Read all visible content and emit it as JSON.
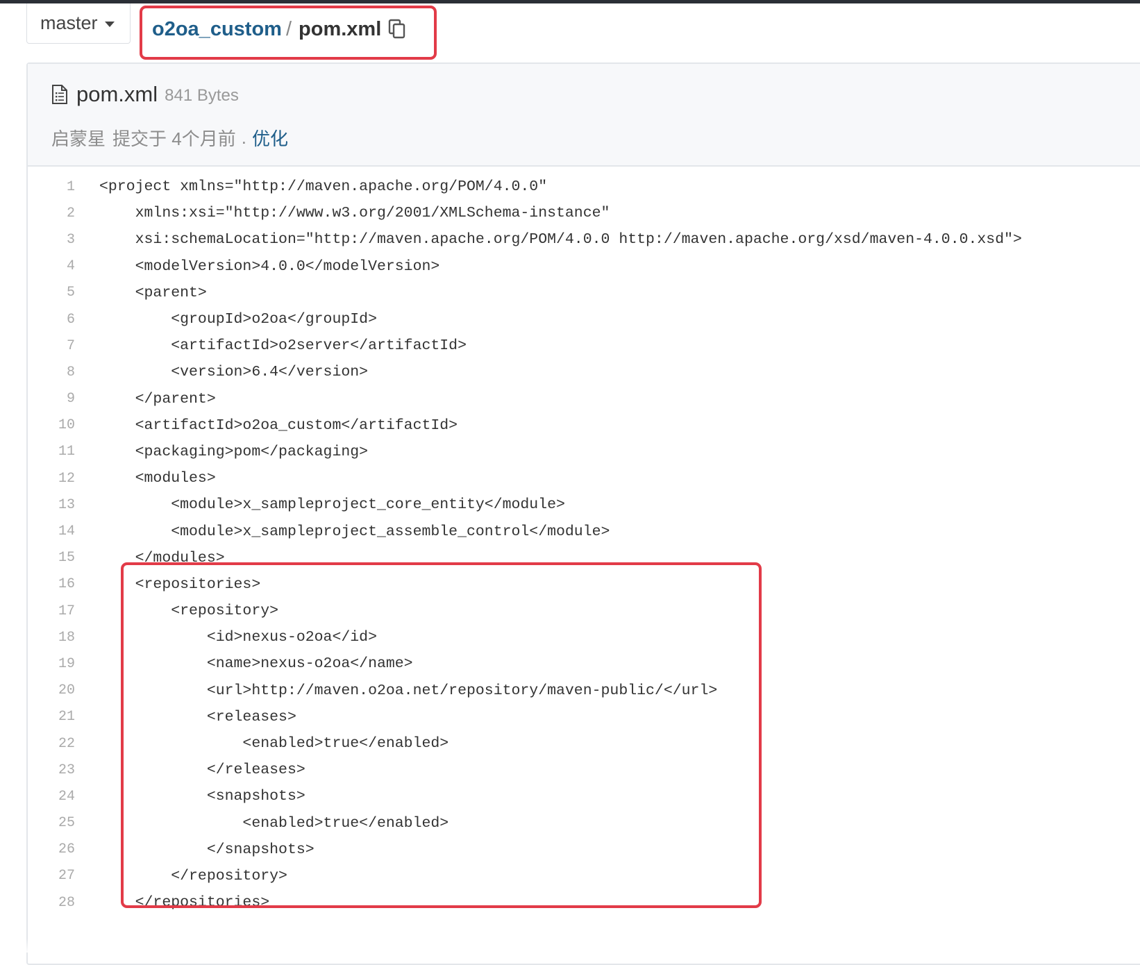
{
  "branch": {
    "label": "master"
  },
  "breadcrumb": {
    "repo": "o2oa_custom",
    "separator": "/",
    "file": "pom.xml"
  },
  "file": {
    "name": "pom.xml",
    "size": "841 Bytes",
    "commit": {
      "author": "启蒙星",
      "action": "提交于 4个月前",
      "dot": ".",
      "message": "优化"
    }
  },
  "code": {
    "lines": [
      {
        "n": "1",
        "text": "<project xmlns=\"http://maven.apache.org/POM/4.0.0\""
      },
      {
        "n": "2",
        "text": "    xmlns:xsi=\"http://www.w3.org/2001/XMLSchema-instance\""
      },
      {
        "n": "3",
        "text": "    xsi:schemaLocation=\"http://maven.apache.org/POM/4.0.0 http://maven.apache.org/xsd/maven-4.0.0.xsd\">"
      },
      {
        "n": "4",
        "text": "    <modelVersion>4.0.0</modelVersion>"
      },
      {
        "n": "5",
        "text": "    <parent>"
      },
      {
        "n": "6",
        "text": "        <groupId>o2oa</groupId>"
      },
      {
        "n": "7",
        "text": "        <artifactId>o2server</artifactId>"
      },
      {
        "n": "8",
        "text": "        <version>6.4</version>"
      },
      {
        "n": "9",
        "text": "    </parent>"
      },
      {
        "n": "10",
        "text": "    <artifactId>o2oa_custom</artifactId>"
      },
      {
        "n": "11",
        "text": "    <packaging>pom</packaging>"
      },
      {
        "n": "12",
        "text": "    <modules>"
      },
      {
        "n": "13",
        "text": "        <module>x_sampleproject_core_entity</module>"
      },
      {
        "n": "14",
        "text": "        <module>x_sampleproject_assemble_control</module>"
      },
      {
        "n": "15",
        "text": "    </modules>"
      },
      {
        "n": "16",
        "text": "    <repositories>"
      },
      {
        "n": "17",
        "text": "        <repository>"
      },
      {
        "n": "18",
        "text": "            <id>nexus-o2oa</id>"
      },
      {
        "n": "19",
        "text": "            <name>nexus-o2oa</name>"
      },
      {
        "n": "20",
        "text": "            <url>http://maven.o2oa.net/repository/maven-public/</url>"
      },
      {
        "n": "21",
        "text": "            <releases>"
      },
      {
        "n": "22",
        "text": "                <enabled>true</enabled>"
      },
      {
        "n": "23",
        "text": "            </releases>"
      },
      {
        "n": "24",
        "text": "            <snapshots>"
      },
      {
        "n": "25",
        "text": "                <enabled>true</enabled>"
      },
      {
        "n": "26",
        "text": "            </snapshots>"
      },
      {
        "n": "27",
        "text": "        </repository>"
      },
      {
        "n": "28",
        "text": "    </repositories>"
      }
    ]
  },
  "colors": {
    "accent": "#e23b48",
    "link": "#1f5e8a"
  }
}
